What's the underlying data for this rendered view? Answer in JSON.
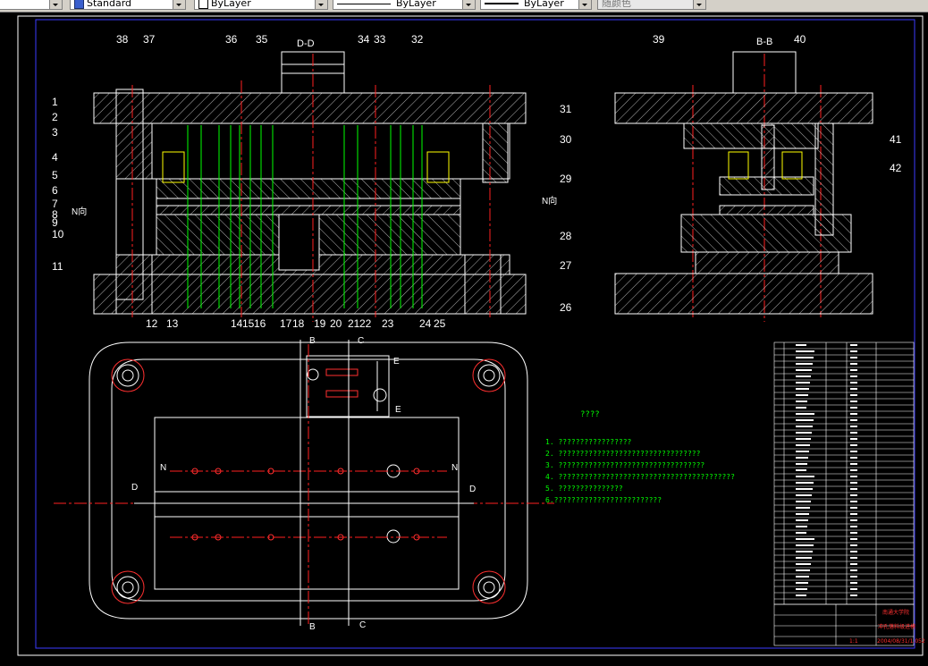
{
  "toolbar": {
    "text_style_value": "Standard",
    "layer_value": "ByLayer",
    "linetype_value": "ByLayer",
    "lineweight_value": "ByLayer",
    "plotstyle_value": "随颜色"
  },
  "drawing": {
    "section_dd": "D-D",
    "section_bb": "B-B",
    "n_label_left": "N向",
    "n_label_right": "N向",
    "callouts": [
      "1",
      "2",
      "3",
      "4",
      "5",
      "6",
      "7",
      "8",
      "9",
      "10",
      "11",
      "12",
      "13",
      "14",
      "15",
      "16",
      "17",
      "18",
      "19",
      "20",
      "21",
      "22",
      "23",
      "24",
      "25",
      "26",
      "27",
      "28",
      "29",
      "30",
      "31",
      "32",
      "33",
      "34",
      "35",
      "36",
      "37",
      "38",
      "39",
      "40",
      "41",
      "42"
    ],
    "view_marks": {
      "B": "B",
      "C": "C",
      "E": "E",
      "D": "D",
      "N": "N"
    },
    "notes_title": "????",
    "notes": [
      "1. ?????????????????",
      "2. ?????????????????????????????????",
      "3. ??????????????????????????????????",
      "4. ?????????????????????????????????????????",
      "5. ???????????????",
      "6.?????????????????????????"
    ],
    "title_block": {
      "school": "南通大学院",
      "drawing_name": "冲孔落料级进模",
      "drawing_no": "2004/08/31/1.052",
      "scale": "1:1"
    }
  }
}
